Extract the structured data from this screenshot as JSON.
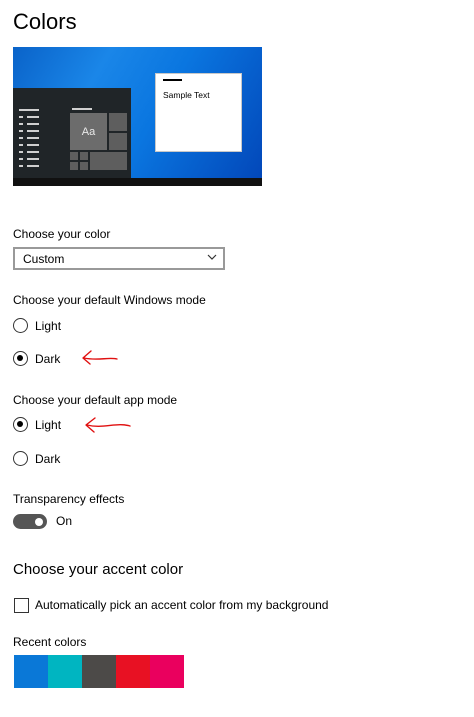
{
  "page": {
    "title": "Colors"
  },
  "preview": {
    "sample_text": "Sample Text",
    "tile_label": "Aa"
  },
  "color_choice": {
    "label": "Choose your color",
    "selected": "Custom"
  },
  "windows_mode": {
    "label": "Choose your default Windows mode",
    "options": [
      {
        "label": "Light",
        "checked": false
      },
      {
        "label": "Dark",
        "checked": true
      }
    ]
  },
  "app_mode": {
    "label": "Choose your default app mode",
    "options": [
      {
        "label": "Light",
        "checked": true
      },
      {
        "label": "Dark",
        "checked": false
      }
    ]
  },
  "transparency": {
    "label": "Transparency effects",
    "state": "On"
  },
  "accent": {
    "heading": "Choose your accent color",
    "auto_pick_label": "Automatically pick an accent color from my background",
    "recent_label": "Recent colors",
    "recent_colors": [
      "#0a78d7",
      "#00b5c1",
      "#4c4a48",
      "#e81123",
      "#ea005e"
    ]
  },
  "annotations": {
    "arrow_color": "#e01010"
  }
}
